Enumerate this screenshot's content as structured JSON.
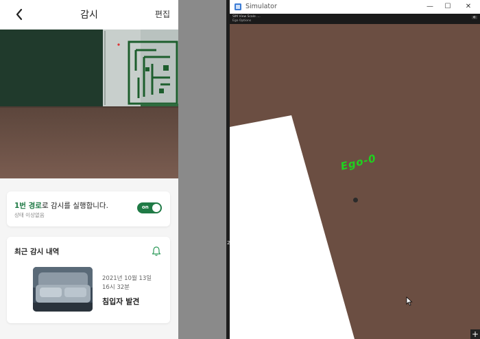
{
  "app": {
    "title": "감시",
    "edit_label": "편집",
    "status": {
      "route_highlight": "1번 경로",
      "route_text": "로 감시를 실행합니다.",
      "sub_text": "상태 이상없음",
      "toggle_label": "on",
      "toggle_on": true
    },
    "history": {
      "title": "최근 감시 내역",
      "event": {
        "date": "2021년 10월 13일",
        "time": "16시 32분",
        "title": "침입자 발견"
      }
    }
  },
  "simulator": {
    "window_title": "Simulator",
    "toolbar_menu": "SIM  View  Scale  ....",
    "toolbar_sub": "Ego Options",
    "left_marker": "2",
    "ego_label": "Ego-0",
    "controls": {
      "minimize": "—",
      "maximize": "☐",
      "close": "✕",
      "add": "+"
    }
  },
  "colors": {
    "accent_green": "#1f7a45",
    "ego_green": "#1fd11f",
    "sim_ground": "#6b4e42"
  }
}
